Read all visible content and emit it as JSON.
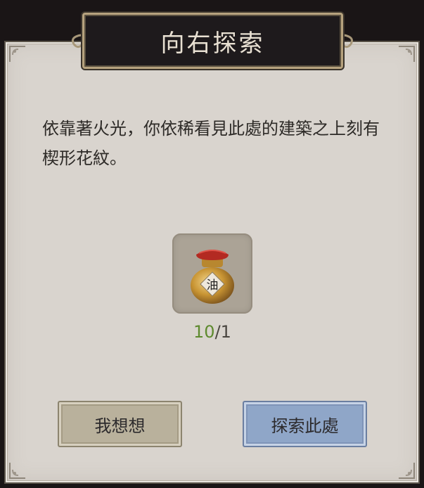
{
  "dialog": {
    "title": "向右探索",
    "description": "依靠著火光，你依稀看見此處的建築之上刻有楔形花紋。"
  },
  "item": {
    "icon": "oil-jar-icon",
    "jar_label": "油",
    "count_have": "10",
    "count_separator": "/",
    "count_need": "1",
    "have_color": "#5e8a2e"
  },
  "buttons": {
    "think_label": "我想想",
    "explore_label": "探索此處"
  },
  "colors": {
    "panel": "#d9d4ce",
    "title_plate": "#1e1a1c",
    "explore_button": "#8fa6c8",
    "think_button": "#b9b19c"
  }
}
